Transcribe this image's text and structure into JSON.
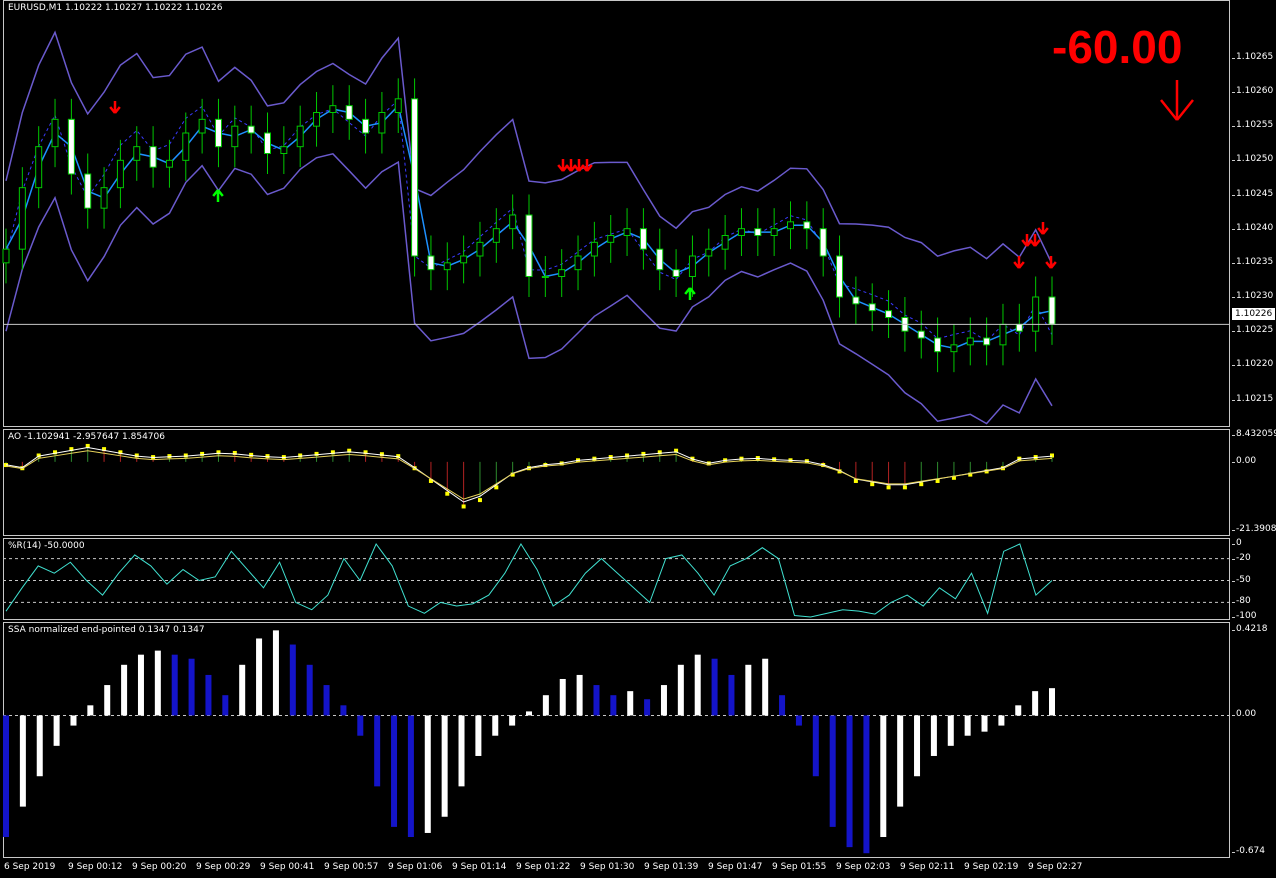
{
  "main": {
    "label": "EURUSD,M1  1.10222 1.10227 1.10222 1.10226",
    "symbol": "EURUSD,M1",
    "big_value": "-60.00",
    "current_price": "1.10226",
    "y_ticks": [
      "1.10265",
      "1.10260",
      "1.10255",
      "1.10250",
      "1.10245",
      "1.10240",
      "1.10235",
      "1.10230",
      "1.10225",
      "1.10220",
      "1.10215"
    ],
    "colors": {
      "bull": "#00c800",
      "bear": "#ffffff",
      "band": "#6a5acd",
      "ma": "#1e90ff",
      "arrow_up": "#00ff00",
      "arrow_down": "#ff0000"
    },
    "signal_icons": [
      "arrow-up-icon",
      "arrow-down-icon"
    ]
  },
  "ao": {
    "label": "AO -1.102941 -2.957647 1.854706",
    "y_ticks": [
      "8.432059",
      "0.00",
      "-21.39088"
    ]
  },
  "wpr": {
    "label": "%R(14) -50.0000",
    "y_ticks": [
      "0",
      "-20",
      "-50",
      "-80",
      "-100"
    ]
  },
  "ssa": {
    "label": "SSA normalized end-pointed 0.1347 0.1347",
    "y_ticks": [
      "0.4218",
      "0.00",
      "-0.674"
    ]
  },
  "x_ticks": [
    "6 Sep 2019",
    "9 Sep 00:12",
    "9 Sep 00:20",
    "9 Sep 00:29",
    "9 Sep 00:41",
    "9 Sep 00:57",
    "9 Sep 01:06",
    "9 Sep 01:14",
    "9 Sep 01:22",
    "9 Sep 01:30",
    "9 Sep 01:39",
    "9 Sep 01:47",
    "9 Sep 01:55",
    "9 Sep 02:03",
    "9 Sep 02:11",
    "9 Sep 02:19",
    "9 Sep 02:27"
  ],
  "chart_data": [
    {
      "type": "candlestick",
      "title": "EURUSD,M1",
      "ylim": [
        1.10212,
        1.10272
      ],
      "series": [
        {
          "name": "EURUSD,M1",
          "close": [
            1.10237,
            1.10246,
            1.10252,
            1.10256,
            1.10248,
            1.10243,
            1.10246,
            1.1025,
            1.10252,
            1.10249,
            1.1025,
            1.10254,
            1.10256,
            1.10252,
            1.10255,
            1.10254,
            1.10251,
            1.10252,
            1.10255,
            1.10257,
            1.10258,
            1.10256,
            1.10254,
            1.10257,
            1.10259,
            1.10236,
            1.10234,
            1.10235,
            1.10236,
            1.10238,
            1.1024,
            1.10242,
            1.10233,
            1.10233,
            1.10234,
            1.10236,
            1.10238,
            1.10239,
            1.1024,
            1.10237,
            1.10234,
            1.10233,
            1.10236,
            1.10237,
            1.10239,
            1.1024,
            1.10239,
            1.1024,
            1.10241,
            1.1024,
            1.10236,
            1.1023,
            1.10229,
            1.10228,
            1.10227,
            1.10225,
            1.10224,
            1.10222,
            1.10223,
            1.10224,
            1.10223,
            1.10226,
            1.10225,
            1.1023,
            1.10226
          ]
        }
      ]
    },
    {
      "type": "bar",
      "title": "AO",
      "ylim": [
        -21.39088,
        8.432059
      ],
      "series": [
        {
          "name": "AO",
          "values": [
            -1,
            -2,
            2,
            3,
            4,
            5,
            4,
            3,
            2,
            1.5,
            1.8,
            2,
            2.5,
            3,
            2.8,
            2.2,
            1.8,
            1.5,
            2,
            2.5,
            3,
            3.5,
            3,
            2.4,
            1.8,
            -2,
            -6,
            -10,
            -14,
            -12,
            -8,
            -4,
            -2,
            -1,
            -0.5,
            0.5,
            1,
            1.5,
            2,
            2.5,
            3,
            3.5,
            1,
            -0.5,
            0.5,
            1,
            1.2,
            0.8,
            0.5,
            0.2,
            -1,
            -3,
            -6,
            -7,
            -8,
            -8,
            -7,
            -6,
            -5,
            -4,
            -3,
            -2,
            1,
            1.5,
            2
          ]
        }
      ]
    },
    {
      "type": "line",
      "title": "%R(14)",
      "ylim": [
        -100,
        0
      ],
      "series": [
        {
          "name": "%R(14)",
          "values": [
            -92,
            -60,
            -30,
            -40,
            -25,
            -50,
            -70,
            -40,
            -15,
            -30,
            -55,
            -35,
            -50,
            -45,
            -10,
            -35,
            -60,
            -25,
            -80,
            -90,
            -70,
            -20,
            -50,
            0,
            -30,
            -85,
            -95,
            -80,
            -85,
            -82,
            -70,
            -40,
            0,
            -35,
            -85,
            -70,
            -40,
            -20,
            -40,
            -60,
            -80,
            -20,
            -15,
            -40,
            -70,
            -30,
            -20,
            -5,
            -20,
            -98,
            -100,
            -95,
            -90,
            -92,
            -96,
            -80,
            -70,
            -85,
            -60,
            -75,
            -40,
            -95,
            -10,
            0,
            -70,
            -50
          ]
        }
      ]
    },
    {
      "type": "bar",
      "title": "SSA normalized end-pointed",
      "ylim": [
        -0.674,
        0.4218
      ],
      "series": [
        {
          "name": "SSA",
          "values": [
            -0.6,
            -0.45,
            -0.3,
            -0.15,
            -0.05,
            0.05,
            0.15,
            0.25,
            0.3,
            0.32,
            0.3,
            0.28,
            0.2,
            0.1,
            0.25,
            0.38,
            0.42,
            0.35,
            0.25,
            0.15,
            0.05,
            -0.1,
            -0.35,
            -0.55,
            -0.6,
            -0.58,
            -0.5,
            -0.35,
            -0.2,
            -0.1,
            -0.05,
            0.02,
            0.1,
            0.18,
            0.2,
            0.15,
            0.1,
            0.12,
            0.08,
            0.15,
            0.25,
            0.3,
            0.28,
            0.2,
            0.25,
            0.28,
            0.1,
            -0.05,
            -0.3,
            -0.55,
            -0.65,
            -0.68,
            -0.6,
            -0.45,
            -0.3,
            -0.2,
            -0.15,
            -0.1,
            -0.08,
            -0.05,
            0.05,
            0.12,
            0.1347
          ]
        }
      ]
    }
  ]
}
